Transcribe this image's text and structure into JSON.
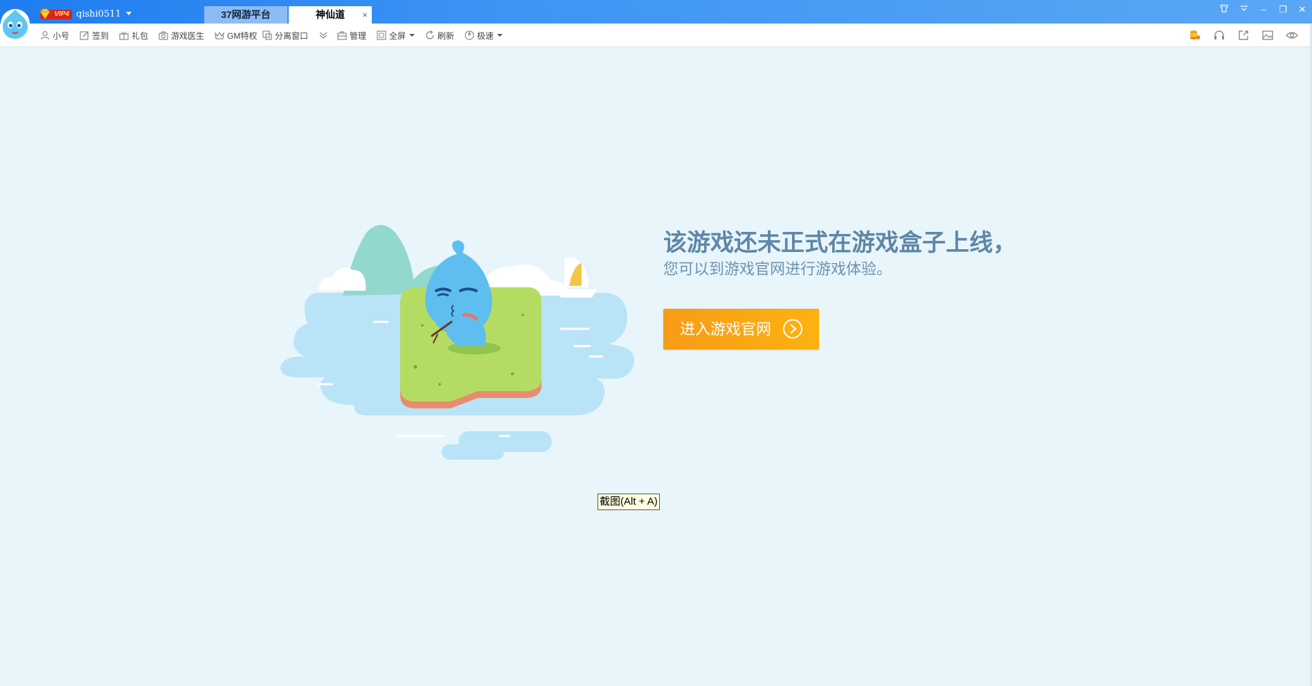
{
  "titlebar": {
    "vip_label": "VIP4",
    "username": "qishi0511",
    "tabs": [
      {
        "label": "37网游平台"
      },
      {
        "label": "神仙道",
        "close": "×"
      }
    ],
    "window_controls": {
      "skin": "skin-icon",
      "menu": "menu-icon",
      "minimize": "–",
      "restore": "❐",
      "close": "✕"
    }
  },
  "toolbar": {
    "items": [
      {
        "label": "小号",
        "icon": "user-icon"
      },
      {
        "label": "签到",
        "icon": "edit-icon"
      },
      {
        "label": "礼包",
        "icon": "gift-icon"
      },
      {
        "label": "游戏医生",
        "icon": "camera-icon"
      },
      {
        "label": "GM特权",
        "icon": "crown-icon"
      },
      {
        "label": "分离窗口",
        "icon": "window-icon"
      },
      {
        "label": "",
        "icon": "double-chevron-down-icon"
      },
      {
        "label": "管理",
        "icon": "briefcase-icon"
      },
      {
        "label": "全屏",
        "icon": "fullscreen-icon",
        "dropdown": true
      },
      {
        "label": "刷新",
        "icon": "refresh-icon"
      },
      {
        "label": "极速",
        "icon": "speed-icon",
        "dropdown": true
      }
    ],
    "right_icons": [
      "coins-icon",
      "headset-icon",
      "share-icon",
      "image-icon",
      "eye-icon"
    ],
    "colors": {
      "coins": "#f0a010",
      "icon": "#8a8a8a"
    }
  },
  "main": {
    "headline": "该游戏还未正式在游戏盒子上线，",
    "subline": "您可以到游戏官网进行游戏体验。",
    "enter_button": "进入游戏官网",
    "screenshot_tip": "截图(Alt + A)",
    "colors": {
      "background": "#e8f5fb",
      "headline": "#5e87a7",
      "button": "#f9a513"
    }
  }
}
